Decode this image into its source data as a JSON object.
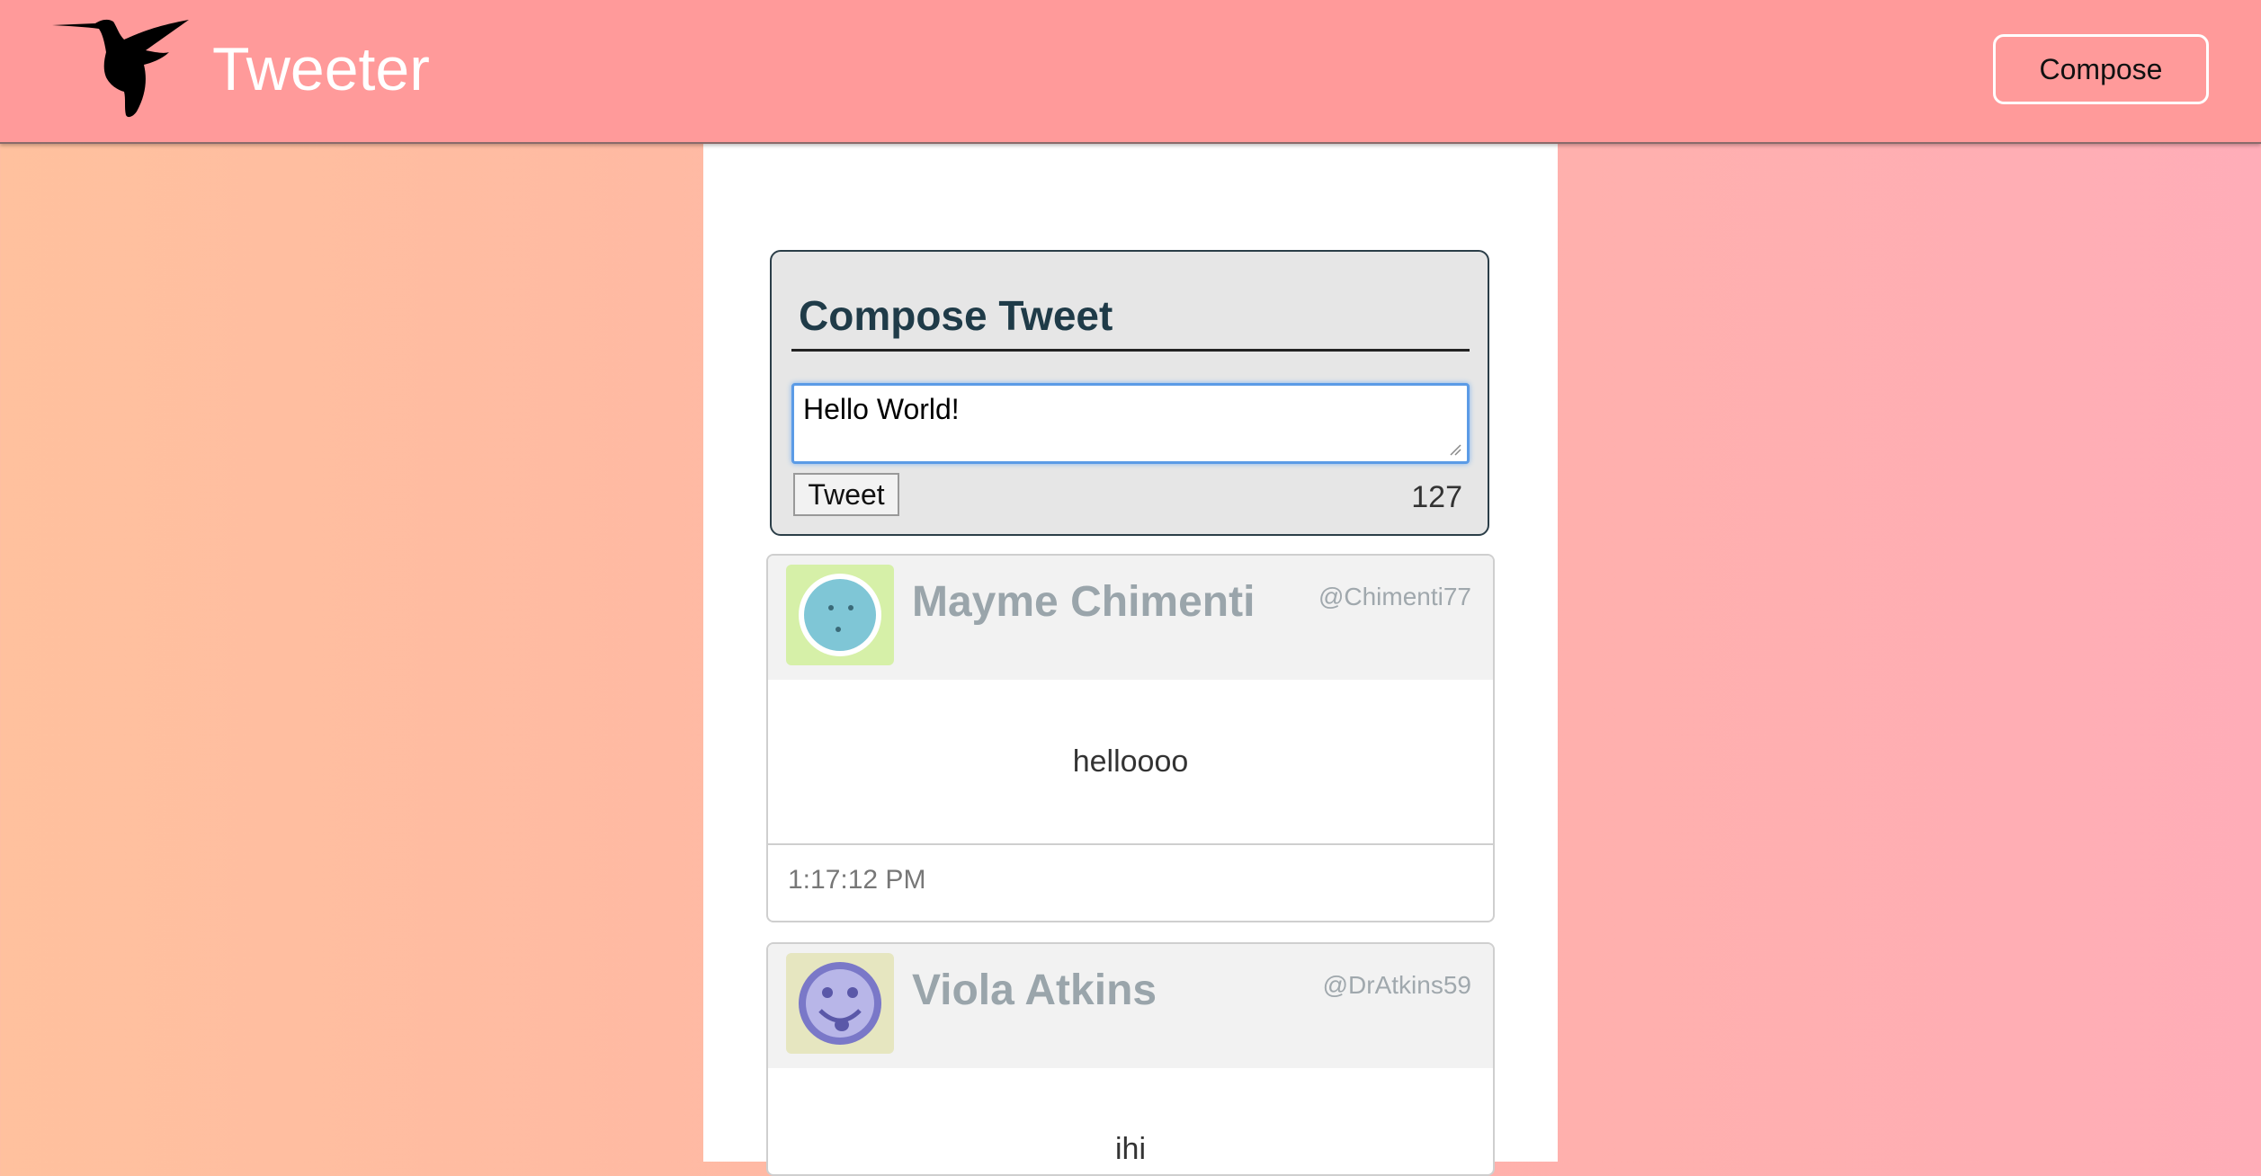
{
  "nav": {
    "brand": "Tweeter",
    "compose_label": "Compose"
  },
  "compose": {
    "title": "Compose Tweet",
    "input_value": "Hello World!",
    "button_label": "Tweet",
    "counter": "127"
  },
  "tweets": [
    {
      "name": "Mayme Chimenti",
      "handle": "@Chimenti77",
      "content": "helloooo",
      "time": "1:17:12 PM"
    },
    {
      "name": "Viola Atkins",
      "handle": "@DrAtkins59",
      "content": "ihi",
      "time": ""
    }
  ],
  "colors": {
    "nav_bg": "#ff9a9a",
    "title_color": "#1f3b48",
    "input_focus": "#5b9be6",
    "card_header_bg": "#f2f2f2"
  },
  "icons": {
    "logo": "hummingbird-icon",
    "avatar1": "smiley-avatar-icon",
    "avatar2": "tongue-smiley-avatar-icon"
  }
}
